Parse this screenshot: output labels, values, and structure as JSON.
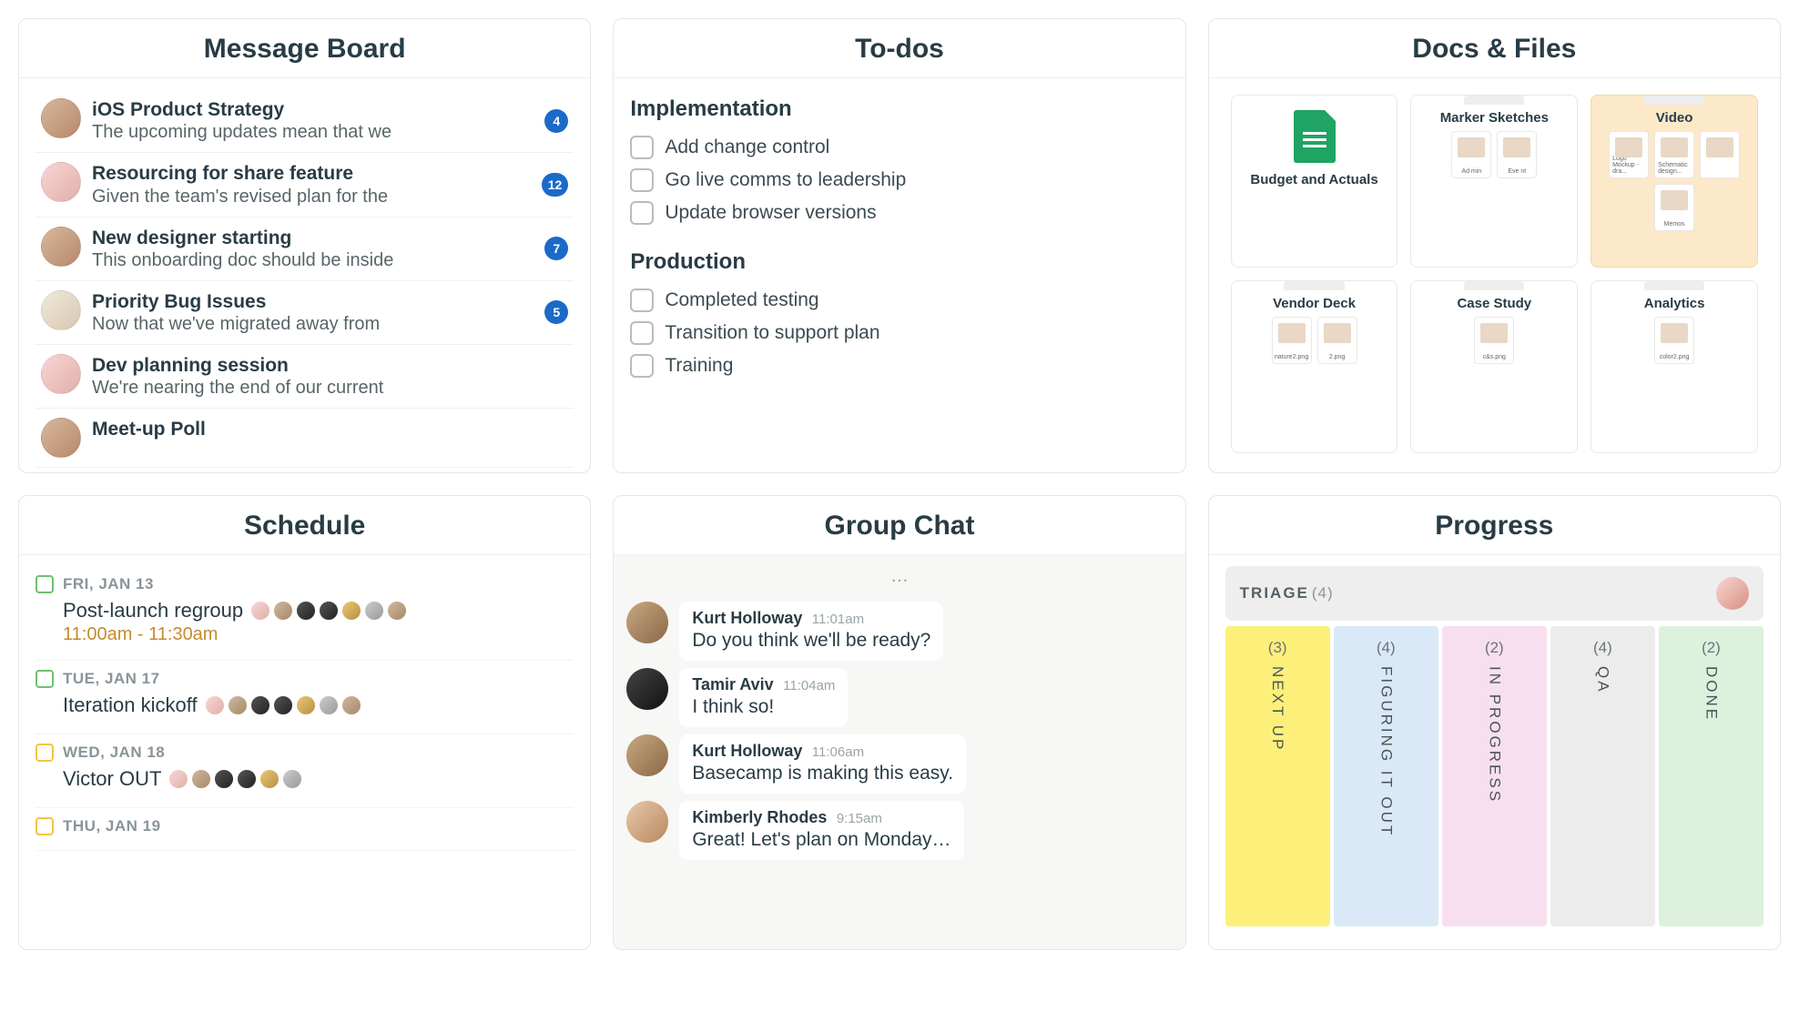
{
  "cards": {
    "message_board": {
      "title": "Message Board",
      "items": [
        {
          "title": "iOS Product Strategy",
          "preview": "The upcoming updates mean that we",
          "count": "4"
        },
        {
          "title": "Resourcing for share feature",
          "preview": "Given the team's revised plan for the",
          "count": "12"
        },
        {
          "title": "New designer starting",
          "preview": "This onboarding doc should be inside",
          "count": "7"
        },
        {
          "title": "Priority Bug Issues",
          "preview": "Now that we've migrated away from",
          "count": "5"
        },
        {
          "title": "Dev planning session",
          "preview": "We're nearing the end of our current",
          "count": ""
        },
        {
          "title": "Meet-up Poll",
          "preview": "",
          "count": ""
        }
      ]
    },
    "todos": {
      "title": "To-dos",
      "groups": [
        {
          "name": "Implementation",
          "items": [
            "Add change control",
            "Go live comms to leadership",
            "Update browser versions"
          ]
        },
        {
          "name": "Production",
          "items": [
            "Completed testing",
            "Transition to support plan",
            "Training"
          ]
        }
      ]
    },
    "docs": {
      "title": "Docs & Files",
      "items": [
        {
          "title": "Budget and Actuals",
          "type": "sheet"
        },
        {
          "title": "Marker Sketches",
          "type": "folder",
          "thumbs": [
            "Ad min",
            "Eve nt"
          ]
        },
        {
          "title": "Video",
          "type": "folder-highlight",
          "thumbs": [
            "Logo Mockup - dra...",
            "Schematic design...",
            " ",
            "Memos"
          ]
        },
        {
          "title": "Vendor Deck",
          "type": "folder",
          "thumbs": [
            "nature2.png",
            "2.png"
          ]
        },
        {
          "title": "Case Study",
          "type": "folder",
          "thumbs": [
            "c&s.png"
          ]
        },
        {
          "title": "Analytics",
          "type": "folder",
          "thumbs": [
            "color2.png"
          ]
        }
      ]
    },
    "schedule": {
      "title": "Schedule",
      "items": [
        {
          "date": "FRI, JAN 13",
          "event": "Post-launch regroup",
          "time": "11:00am - 11:30am",
          "color": "green",
          "avatars": 7
        },
        {
          "date": "TUE, JAN 17",
          "event": "Iteration kickoff",
          "time": "",
          "color": "green",
          "avatars": 7
        },
        {
          "date": "WED, JAN 18",
          "event": "Victor OUT",
          "time": "",
          "color": "yellow",
          "avatars": 6
        },
        {
          "date": "THU, JAN 19",
          "event": "",
          "time": "",
          "color": "yellow",
          "avatars": 0
        }
      ]
    },
    "chat": {
      "title": "Group Chat",
      "messages": [
        {
          "name": "Kurt Holloway",
          "time": "11:01am",
          "text": "Do you think we'll be ready?"
        },
        {
          "name": "Tamir Aviv",
          "time": "11:04am",
          "text": "I think so!"
        },
        {
          "name": "Kurt Holloway",
          "time": "11:06am",
          "text": "Basecamp is making this easy."
        },
        {
          "name": "Kimberly Rhodes",
          "time": "9:15am",
          "text": "Great! Let's plan on Monday…"
        }
      ]
    },
    "progress": {
      "title": "Progress",
      "triage": {
        "label": "TRIAGE",
        "count": "(4)"
      },
      "columns": [
        {
          "count": "(3)",
          "name": "NEXT UP",
          "class": "col-yellow"
        },
        {
          "count": "(4)",
          "name": "FIGURING IT OUT",
          "class": "col-blue"
        },
        {
          "count": "(2)",
          "name": "IN PROGRESS",
          "class": "col-pink"
        },
        {
          "count": "(4)",
          "name": "QA",
          "class": "col-gray"
        },
        {
          "count": "(2)",
          "name": "DONE",
          "class": "col-green"
        }
      ]
    }
  }
}
